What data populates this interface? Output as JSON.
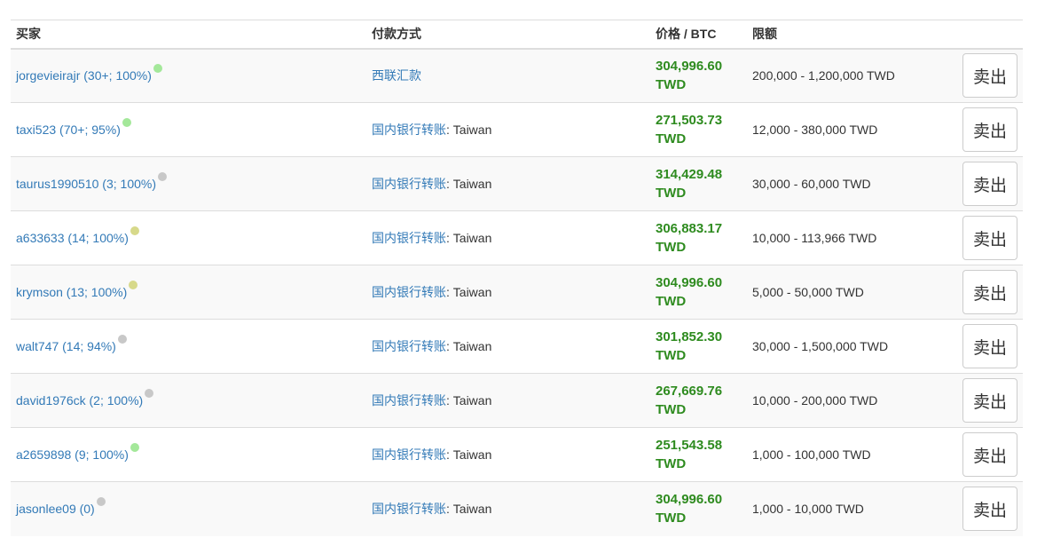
{
  "headers": {
    "buyer": "买家",
    "payment": "付款方式",
    "price": "价格 / BTC",
    "limit": "限额"
  },
  "colors": {
    "online": "#a4e89a",
    "recent": "#d7d98a",
    "offline": "#c8c8c8",
    "link": "#337ab7",
    "price": "#2e8b1f"
  },
  "rows": [
    {
      "buyer": "jorgevieirajr (30+; 100%)",
      "status": "online",
      "payment_method": "西联汇款",
      "payment_detail": "",
      "price": "304,996.60 TWD",
      "limit": "200,000 - 1,200,000 TWD",
      "action": "卖出"
    },
    {
      "buyer": "taxi523 (70+; 95%)",
      "status": "online",
      "payment_method": "国内银行转账",
      "payment_detail": ": Taiwan",
      "price": "271,503.73 TWD",
      "limit": "12,000 - 380,000 TWD",
      "action": "卖出"
    },
    {
      "buyer": "taurus1990510 (3; 100%)",
      "status": "offline",
      "payment_method": "国内银行转账",
      "payment_detail": ": Taiwan",
      "price": "314,429.48 TWD",
      "limit": "30,000 - 60,000 TWD",
      "action": "卖出"
    },
    {
      "buyer": "a633633 (14; 100%)",
      "status": "recent",
      "payment_method": "国内银行转账",
      "payment_detail": ": Taiwan",
      "price": "306,883.17 TWD",
      "limit": "10,000 - 113,966 TWD",
      "action": "卖出"
    },
    {
      "buyer": "krymson (13; 100%)",
      "status": "recent",
      "payment_method": "国内银行转账",
      "payment_detail": ": Taiwan",
      "price": "304,996.60 TWD",
      "limit": "5,000 - 50,000 TWD",
      "action": "卖出"
    },
    {
      "buyer": "walt747 (14; 94%)",
      "status": "offline",
      "payment_method": "国内银行转账",
      "payment_detail": ": Taiwan",
      "price": "301,852.30 TWD",
      "limit": "30,000 - 1,500,000 TWD",
      "action": "卖出"
    },
    {
      "buyer": "david1976ck (2; 100%)",
      "status": "offline",
      "payment_method": "国内银行转账",
      "payment_detail": ": Taiwan",
      "price": "267,669.76 TWD",
      "limit": "10,000 - 200,000 TWD",
      "action": "卖出"
    },
    {
      "buyer": "a2659898 (9; 100%)",
      "status": "online",
      "payment_method": "国内银行转账",
      "payment_detail": ": Taiwan",
      "price": "251,543.58 TWD",
      "limit": "1,000 - 100,000 TWD",
      "action": "卖出"
    },
    {
      "buyer": "jasonlee09 (0)",
      "status": "offline",
      "payment_method": "国内银行转账",
      "payment_detail": ": Taiwan",
      "price": "304,996.60 TWD",
      "limit": "1,000 - 10,000 TWD",
      "action": "卖出"
    }
  ]
}
